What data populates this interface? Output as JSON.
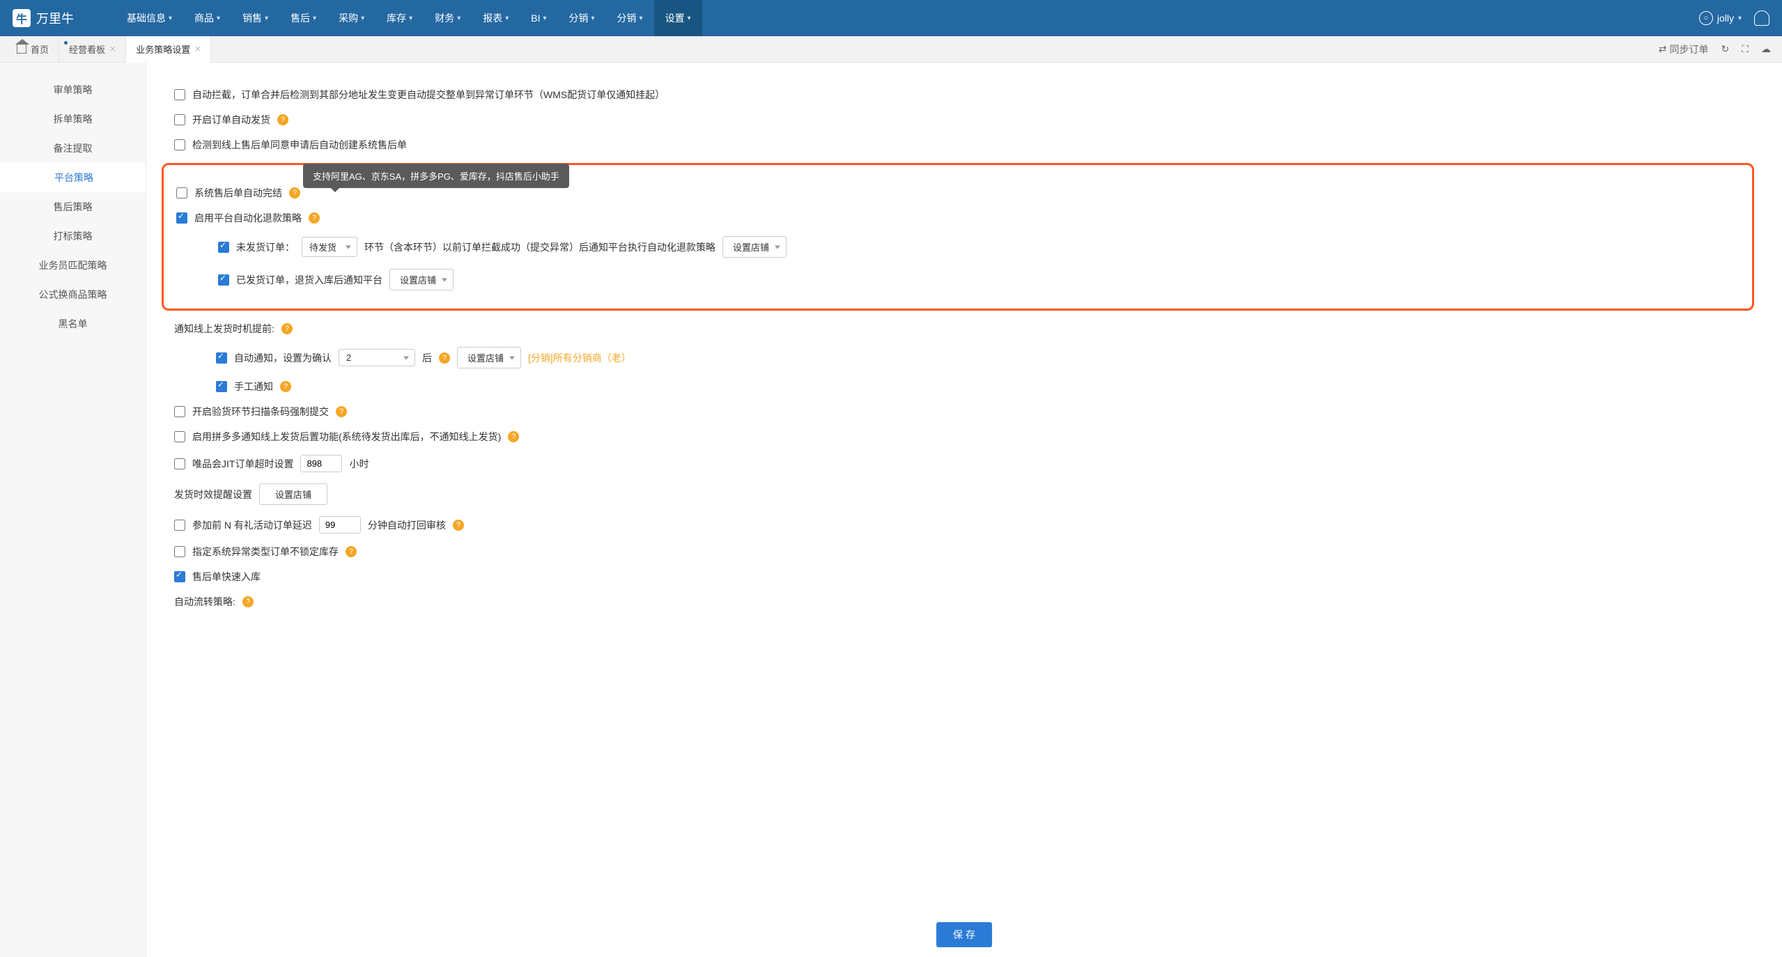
{
  "brand": "万里牛",
  "nav": [
    "基础信息",
    "商品",
    "销售",
    "售后",
    "采购",
    "库存",
    "财务",
    "报表",
    "BI",
    "分销",
    "分销",
    "设置"
  ],
  "nav_active_index": 11,
  "user": {
    "name": "jolly"
  },
  "tabs": {
    "home": "首页",
    "items": [
      "经营看板",
      "业务策略设置"
    ],
    "active_index": 1
  },
  "tabbar_actions": {
    "sync": "同步订单"
  },
  "sidebar": {
    "items": [
      "审单策略",
      "拆单策略",
      "备注提取",
      "平台策略",
      "售后策略",
      "打标策略",
      "业务员匹配策略",
      "公式换商品策略",
      "黑名单"
    ],
    "active_index": 3
  },
  "tooltip": "支持阿里AG、京东SA，拼多多PG、爱库存，抖店售后小助手",
  "options": {
    "auto_intercept": "自动拦截，订单合并后检测到其部分地址发生变更自动提交整单到异常订单环节（WMS配货订单仅通知挂起）",
    "auto_ship": "开启订单自动发货",
    "after_sale_auto_create": "检测到线上售后单同意申请后自动创建系统售后单",
    "after_sale_auto_finish": "系统售后单自动完结",
    "enable_refund": "启用平台自动化退款策略",
    "refund_unshipped_label": "未发货订单：",
    "refund_unshipped_select": "待发货",
    "refund_unshipped_tail": "环节（含本环节）以前订单拦截成功（提交异常）后通知平台执行自动化退款策略",
    "refund_set_shop": "设置店铺",
    "refund_shipped": "已发货订单，退货入库后通知平台",
    "notify_ship_label": "通知线上发货时机提前:",
    "auto_notify_label": "自动通知，设置为确认",
    "auto_notify_val": "2",
    "auto_notify_after": "后",
    "auto_notify_extra": "[分销]所有分销商（老）",
    "manual_notify": "手工通知",
    "scan_force": "开启验货环节扫描条码强制提交",
    "pdd_notify": "启用拼多多通知线上发货后置功能(系统待发货出库后，不通知线上发货)",
    "vip_jit": "唯品会JIT订单超时设置",
    "vip_jit_val": "898",
    "vip_jit_unit": "小时",
    "ship_remind": "发货时效提醒设置",
    "gift_delay": "参加前 N 有礼活动订单延迟",
    "gift_delay_val": "99",
    "gift_delay_unit": "分钟自动打回审核",
    "no_lock": "指定系统异常类型订单不锁定库存",
    "fast_in": "售后单快速入库",
    "auto_flow": "自动流转策略:"
  },
  "save": "保 存"
}
